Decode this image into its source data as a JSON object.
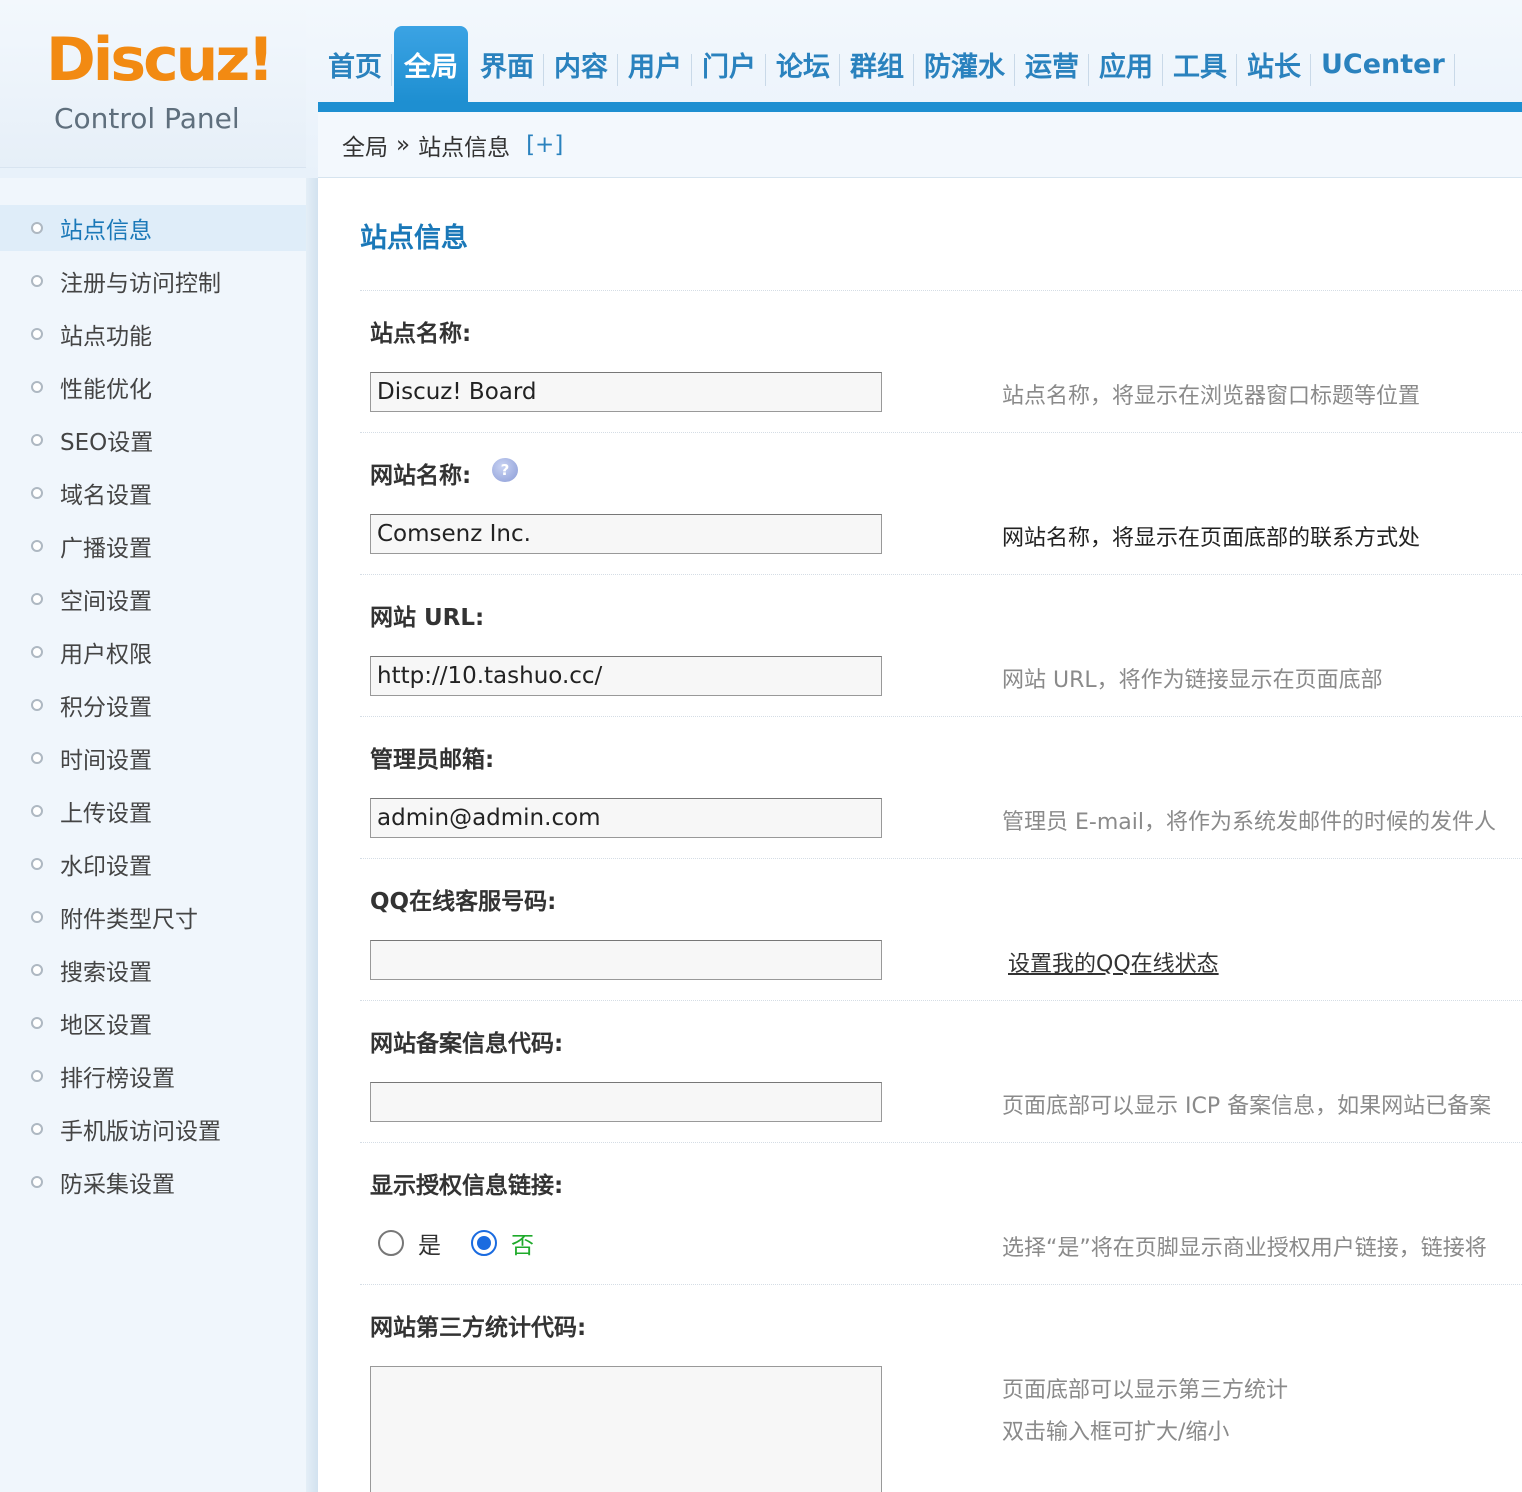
{
  "logo": {
    "main": "Discuz",
    "bang": "!",
    "sub": "Control Panel"
  },
  "topnav": [
    {
      "label": "首页",
      "active": false
    },
    {
      "label": "全局",
      "active": true
    },
    {
      "label": "界面",
      "active": false
    },
    {
      "label": "内容",
      "active": false
    },
    {
      "label": "用户",
      "active": false
    },
    {
      "label": "门户",
      "active": false
    },
    {
      "label": "论坛",
      "active": false
    },
    {
      "label": "群组",
      "active": false
    },
    {
      "label": "防灌水",
      "active": false
    },
    {
      "label": "运营",
      "active": false
    },
    {
      "label": "应用",
      "active": false
    },
    {
      "label": "工具",
      "active": false
    },
    {
      "label": "站长",
      "active": false
    },
    {
      "label": "UCenter",
      "active": false
    }
  ],
  "breadcrumb": {
    "parent": "全局",
    "sep": "»",
    "current": "站点信息",
    "toggle": "[+]"
  },
  "sidebar": {
    "items": [
      {
        "label": "站点信息",
        "active": true
      },
      {
        "label": "注册与访问控制"
      },
      {
        "label": "站点功能"
      },
      {
        "label": "性能优化"
      },
      {
        "label": "SEO设置"
      },
      {
        "label": "域名设置"
      },
      {
        "label": "广播设置"
      },
      {
        "label": "空间设置"
      },
      {
        "label": "用户权限"
      },
      {
        "label": "积分设置"
      },
      {
        "label": "时间设置"
      },
      {
        "label": "上传设置"
      },
      {
        "label": "水印设置"
      },
      {
        "label": "附件类型尺寸"
      },
      {
        "label": "搜索设置"
      },
      {
        "label": "地区设置"
      },
      {
        "label": "排行榜设置"
      },
      {
        "label": "手机版访问设置"
      },
      {
        "label": "防采集设置"
      }
    ]
  },
  "main": {
    "title": "站点信息",
    "fields": {
      "site_name": {
        "label": "站点名称:",
        "value": "Discuz! Board",
        "tip": "站点名称，将显示在浏览器窗口标题等位置"
      },
      "web_name": {
        "label": "网站名称:",
        "value": "Comsenz Inc.",
        "tip": "网站名称，将显示在页面底部的联系方式处",
        "help_icon": "question-icon",
        "help_glyph": "?"
      },
      "site_url": {
        "label": "网站 URL:",
        "value": "http://10.tashuo.cc/",
        "tip": "网站 URL，将作为链接显示在页面底部"
      },
      "admin_email": {
        "label": "管理员邮箱:",
        "value": "admin@admin.com",
        "tip": "管理员 E-mail，将作为系统发邮件的时候的发件人"
      },
      "qq": {
        "label": "QQ在线客服号码:",
        "value": "",
        "link": "设置我的QQ在线状态"
      },
      "icp": {
        "label": "网站备案信息代码:",
        "value": "",
        "tip": "页面底部可以显示 ICP 备案信息，如果网站已备案"
      },
      "license_link": {
        "label": "显示授权信息链接:",
        "yes": "是",
        "no": "否",
        "selected": "否",
        "tip": "选择“是”将在页脚显示商业授权用户链接，链接将"
      },
      "stat_code": {
        "label": "网站第三方统计代码:",
        "value": "",
        "tip1": "页面底部可以显示第三方统计",
        "tip2": "双击输入框可扩大/缩小"
      }
    }
  },
  "colors": {
    "accent": "#1e8fd1",
    "logo": "#f28a12",
    "title": "#1a78b8",
    "radio_selected": "#1a6be0",
    "no_label": "#1eaa2a"
  }
}
